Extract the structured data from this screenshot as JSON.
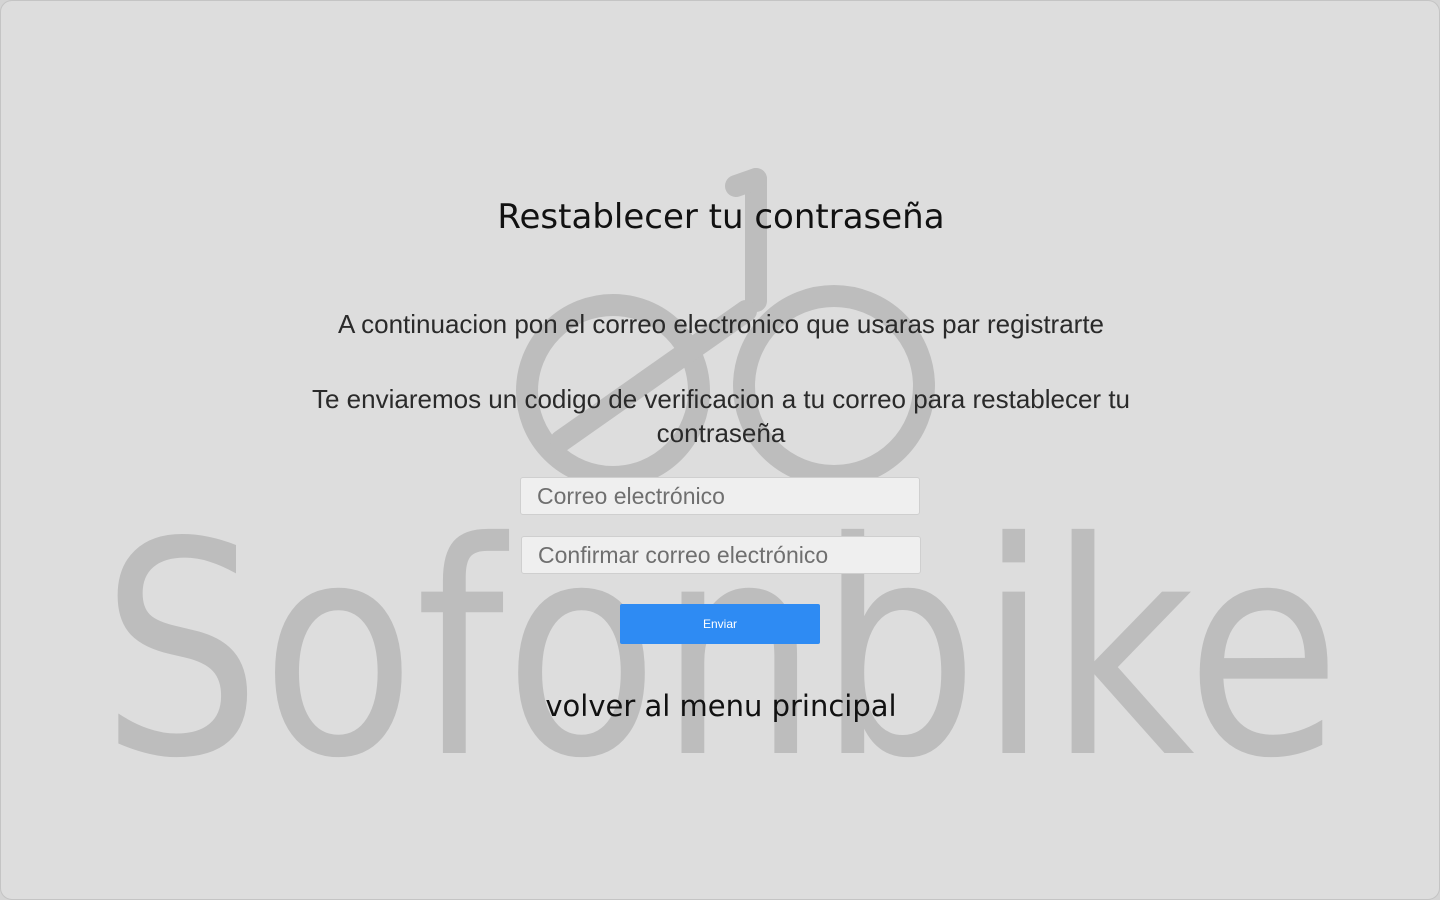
{
  "brand": {
    "logo_text": "Sofonbike",
    "logo_mark_icon": "bike-logo-icon",
    "watermark_color": "#bdbdbd"
  },
  "page": {
    "title": "Restablecer tu contraseña",
    "instruction": "A continuacion pon el correo electronico que usaras par registrarte",
    "notice": "Te enviaremos un codigo de verificacion a tu correo para restablecer tu contraseña"
  },
  "form": {
    "email_placeholder": "Correo electrónico",
    "email_value": "",
    "confirm_email_placeholder": "Confirmar correo electrónico",
    "confirm_email_value": "",
    "submit_label": "Enviar",
    "submit_color": "#2e8bf3"
  },
  "nav": {
    "back_label": "volver al menu principal"
  }
}
